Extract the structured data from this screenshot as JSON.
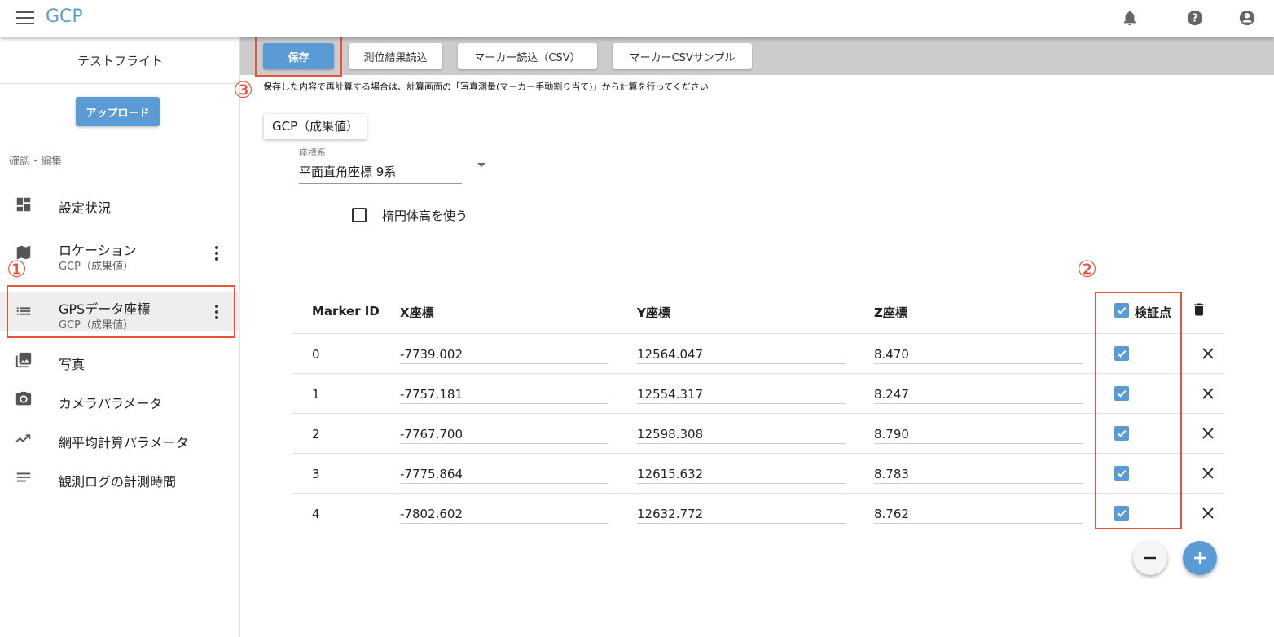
{
  "app": {
    "title": "GCP"
  },
  "header": {
    "icons": [
      "bell-icon",
      "help-icon",
      "account-icon"
    ]
  },
  "sidebar": {
    "flight_name": "テストフライト",
    "upload_label": "アップロード",
    "section_label": "確認・編集",
    "items": [
      {
        "label": "設定状況",
        "sub": "",
        "icon": "dashboard-icon"
      },
      {
        "label": "ロケーション",
        "sub": "GCP（成果値）",
        "icon": "map-icon"
      },
      {
        "label": "GPSデータ座標",
        "sub": "GCP（成果値）",
        "icon": "list-icon",
        "active": true
      },
      {
        "label": "写真",
        "sub": "",
        "icon": "photo-icon"
      },
      {
        "label": "カメラパラメータ",
        "sub": "",
        "icon": "camera-icon"
      },
      {
        "label": "網平均計算パラメータ",
        "sub": "",
        "icon": "trending-icon"
      },
      {
        "label": "観測ログの計測時間",
        "sub": "",
        "icon": "notes-icon"
      }
    ]
  },
  "toolbar": {
    "save_label": "保存",
    "load_result_label": "測位結果読込",
    "load_marker_label": "マーカー読込（CSV）",
    "marker_sample_label": "マーカーCSVサンプル"
  },
  "notice": "保存した内容で再計算する場合は、計算画面の「写真測量(マーカー手動割り当て)」から計算を行ってください",
  "chip_label": "GCP（成果値）",
  "coordinate_system": {
    "label": "座標系",
    "value": "平面直角座標 9系"
  },
  "ellipsoid_height": {
    "label": "楕円体高を使う",
    "checked": false
  },
  "table": {
    "headers": {
      "id": "Marker ID",
      "x": "X座標",
      "y": "Y座標",
      "z": "Z座標",
      "check": "検証点"
    },
    "rows": [
      {
        "id": "0",
        "x": "-7739.002",
        "y": "12564.047",
        "z": "8.470",
        "check": true
      },
      {
        "id": "1",
        "x": "-7757.181",
        "y": "12554.317",
        "z": "8.247",
        "check": true
      },
      {
        "id": "2",
        "x": "-7767.700",
        "y": "12598.308",
        "z": "8.790",
        "check": true
      },
      {
        "id": "3",
        "x": "-7775.864",
        "y": "12615.632",
        "z": "8.783",
        "check": true
      },
      {
        "id": "4",
        "x": "-7802.602",
        "y": "12632.772",
        "z": "8.762",
        "check": true
      }
    ]
  },
  "annotations": {
    "a1": "①",
    "a2": "②",
    "a3": "③"
  },
  "colors": {
    "accent": "#5b9bd5",
    "annotation": "#e8533a",
    "toolbar_bg": "#cccccc"
  }
}
